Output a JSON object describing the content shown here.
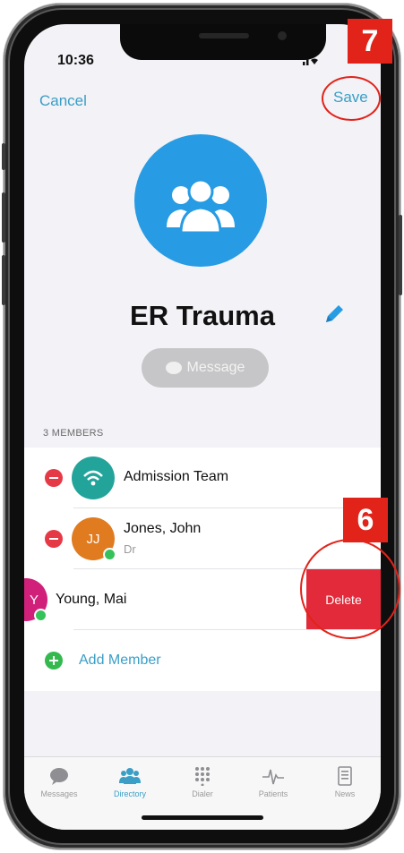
{
  "status_bar": {
    "time": "10:36"
  },
  "nav": {
    "cancel_label": "Cancel",
    "save_label": "Save"
  },
  "group": {
    "name": "ER Trauma",
    "message_button_label": "Message"
  },
  "members": {
    "count_label": "3 MEMBERS",
    "items": [
      {
        "name": "Admission Team",
        "subtitle": "",
        "avatar_color": "#23a49a",
        "avatar_icon": "wifi-icon"
      },
      {
        "name": "Jones, John",
        "subtitle": "Dr",
        "initials": "JJ",
        "avatar_color": "#e07b20",
        "online": true
      },
      {
        "name": "Young, Mai",
        "initials": "Y",
        "avatar_color": "#d1207a",
        "online": true
      }
    ],
    "delete_label": "Delete",
    "add_member_label": "Add Member"
  },
  "tabbar": {
    "tabs": [
      {
        "label": "Messages",
        "icon": "chat-bubble-icon"
      },
      {
        "label": "Directory",
        "icon": "people-icon",
        "active": true
      },
      {
        "label": "Dialer",
        "icon": "keypad-icon"
      },
      {
        "label": "Patients",
        "icon": "heartbeat-icon"
      },
      {
        "label": "News",
        "icon": "document-icon"
      }
    ]
  },
  "annotations": {
    "badge_save": "7",
    "badge_delete": "6"
  },
  "colors": {
    "accent": "#3a9ec6",
    "group_avatar": "#279be3",
    "delete": "#e22a3a",
    "annotation": "#e2231a"
  }
}
